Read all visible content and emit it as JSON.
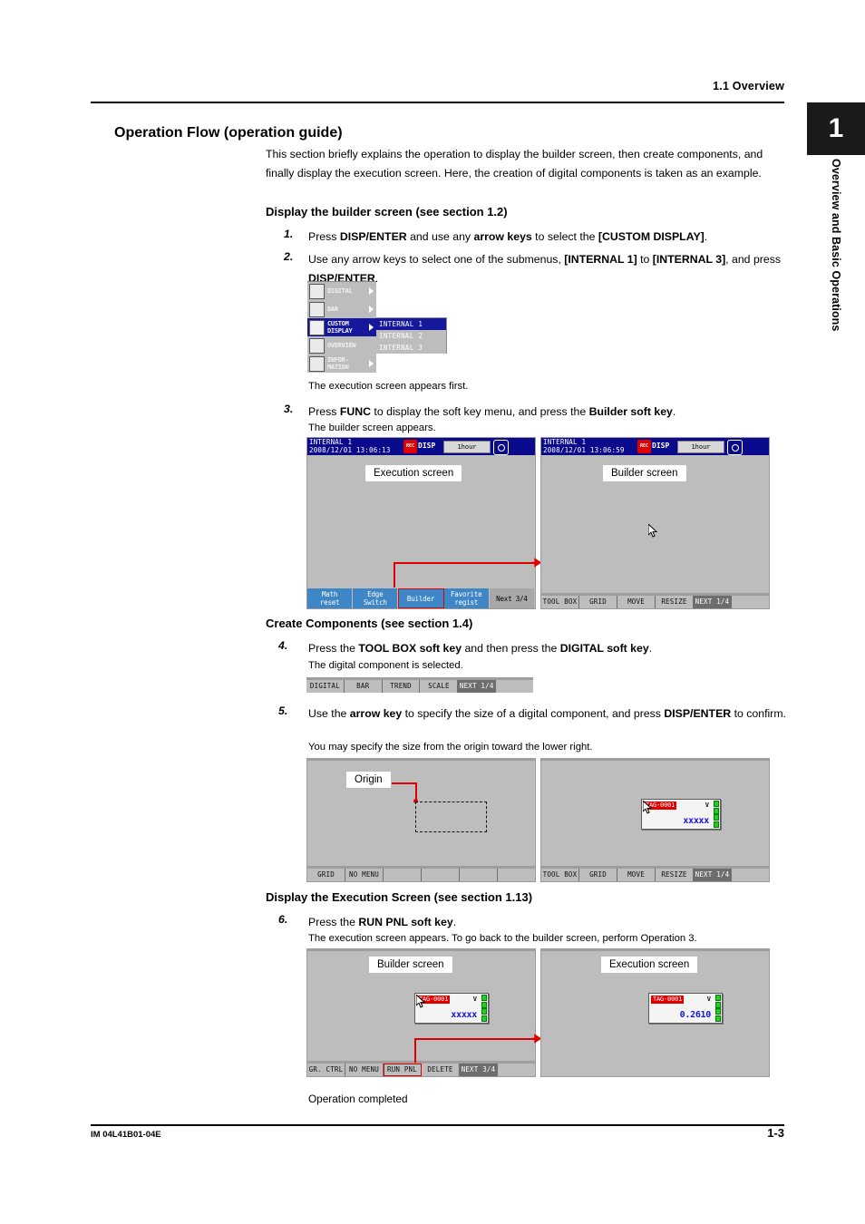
{
  "header": {
    "section": "1.1  Overview"
  },
  "side_tab": {
    "number": "1",
    "title": "Overview and Basic Operations"
  },
  "section": {
    "title": "Operation Flow (operation guide)",
    "intro": "This section briefly explains the operation to display the builder screen, then create components, and finally display the execution screen. Here, the creation of digital components is taken as an example."
  },
  "part1": {
    "heading": "Display the builder screen (see section 1.2)",
    "step1_num": "1.",
    "step2_num": "2.",
    "step3_num": "3.",
    "step3_note": "The builder screen appears.",
    "step2_note": "The execution screen appears first."
  },
  "part2": {
    "heading": "Create Components (see section 1.4)",
    "step4_num": "4.",
    "step4_note": "The digital component is selected.",
    "step5_num": "5.",
    "step5_note": "You may specify the size from the origin toward the lower right."
  },
  "part3": {
    "heading": "Display the Execution Screen (see section 1.13)",
    "step6_num": "6.",
    "step6_note": "The execution screen appears. To go back to the builder screen, perform Operation 3."
  },
  "menu": {
    "items": [
      {
        "label": "DIGITAL",
        "selected": false,
        "arrow": true,
        "icon": "digital-icon"
      },
      {
        "label": "BAR",
        "selected": false,
        "arrow": true,
        "icon": "bar-icon"
      },
      {
        "label": "CUSTOM\nDISPLAY",
        "selected": true,
        "arrow": true,
        "icon": "custom-display-icon"
      },
      {
        "label": "OVERVIEW",
        "selected": false,
        "arrow": false,
        "icon": "overview-icon"
      },
      {
        "label": "INFOR-\nMATION",
        "selected": false,
        "arrow": true,
        "icon": "information-icon"
      }
    ],
    "submenu": [
      {
        "label": "INTERNAL 1",
        "selected": true
      },
      {
        "label": "INTERNAL 2",
        "selected": false
      },
      {
        "label": "INTERNAL 3",
        "selected": false
      }
    ]
  },
  "screens": {
    "exec_header": {
      "tag": "INTERNAL 1",
      "datetime": "2008/12/01 13:06:13",
      "disp": "DISP",
      "rate": "1hour",
      "rec_icon": "recording-icon",
      "circle_icon": "status-circle-icon"
    },
    "builder_header": {
      "tag": "INTERNAL 1",
      "datetime": "2008/12/01 13:06:59",
      "disp": "DISP",
      "rate": "1hour",
      "rec_icon": "recording-icon",
      "circle_icon": "status-circle-icon"
    },
    "label_execution": "Execution screen",
    "label_builder": "Builder screen",
    "label_origin": "Origin",
    "exec_softkeys": [
      {
        "label": "Math\nreset",
        "style": "blue",
        "marked": false
      },
      {
        "label": "Edge\nSwitch",
        "style": "blue",
        "marked": false
      },
      {
        "label": "Builder",
        "style": "blue",
        "marked": true
      },
      {
        "label": "Favorite\nregist",
        "style": "blue",
        "marked": false
      },
      {
        "label": "Next 3/4",
        "style": "grey",
        "marked": false
      }
    ],
    "builder_softkeys": [
      {
        "label": "TOOL BOX",
        "inverted": false,
        "marked": false
      },
      {
        "label": "GRID",
        "inverted": false,
        "marked": false
      },
      {
        "label": "MOVE",
        "inverted": false,
        "marked": false
      },
      {
        "label": "RESIZE",
        "inverted": false,
        "marked": false
      },
      {
        "label": "NEXT 1/4",
        "inverted": true,
        "marked": false
      },
      {
        "label": "",
        "inverted": false,
        "marked": false
      }
    ],
    "toolbox_strip": [
      {
        "label": "DIGITAL",
        "inverted": false
      },
      {
        "label": "BAR",
        "inverted": false
      },
      {
        "label": "TREND",
        "inverted": false
      },
      {
        "label": "SCALE",
        "inverted": false
      },
      {
        "label": "NEXT 1/4",
        "inverted": true
      },
      {
        "label": "",
        "inverted": false
      }
    ],
    "origin_softkeys": [
      {
        "label": "GRID",
        "inverted": false,
        "marked": false
      },
      {
        "label": "NO MENU",
        "inverted": false,
        "marked": false
      },
      {
        "label": "",
        "inverted": false,
        "marked": false
      },
      {
        "label": "",
        "inverted": false,
        "marked": false
      },
      {
        "label": "",
        "inverted": false,
        "marked": false
      },
      {
        "label": "",
        "inverted": false,
        "marked": false
      }
    ],
    "sized_softkeys": [
      {
        "label": "TOOL BOX",
        "inverted": false,
        "marked": false
      },
      {
        "label": "GRID",
        "inverted": false,
        "marked": false
      },
      {
        "label": "MOVE",
        "inverted": false,
        "marked": false
      },
      {
        "label": "RESIZE",
        "inverted": false,
        "marked": false
      },
      {
        "label": "NEXT 1/4",
        "inverted": true,
        "marked": false
      },
      {
        "label": "",
        "inverted": false,
        "marked": false
      }
    ],
    "runpnl_softkeys": [
      {
        "label": "GR. CTRL",
        "inverted": false,
        "marked": false
      },
      {
        "label": "NO MENU",
        "inverted": false,
        "marked": false
      },
      {
        "label": "RUN PNL",
        "inverted": false,
        "marked": true
      },
      {
        "label": "DELETE",
        "inverted": false,
        "marked": false
      },
      {
        "label": "NEXT 3/4",
        "inverted": true,
        "marked": false
      },
      {
        "label": "",
        "inverted": false,
        "marked": false
      }
    ]
  },
  "component": {
    "tag": "TAG-0001",
    "unit": "V",
    "placeholder_value": "xxxxx",
    "live_value": "0.2610"
  },
  "completed": "Operation completed",
  "footer": {
    "doc_id": "IM 04L41B01-04E",
    "page": "1-3"
  },
  "colors": {
    "lcd_bg": "#bdbdbd",
    "titlebar": "#0a0a8c",
    "softkey_blue": "#3e86c6",
    "accent_red": "#e00000",
    "value_blue": "#1414dd",
    "alarm_green": "#19d219"
  }
}
